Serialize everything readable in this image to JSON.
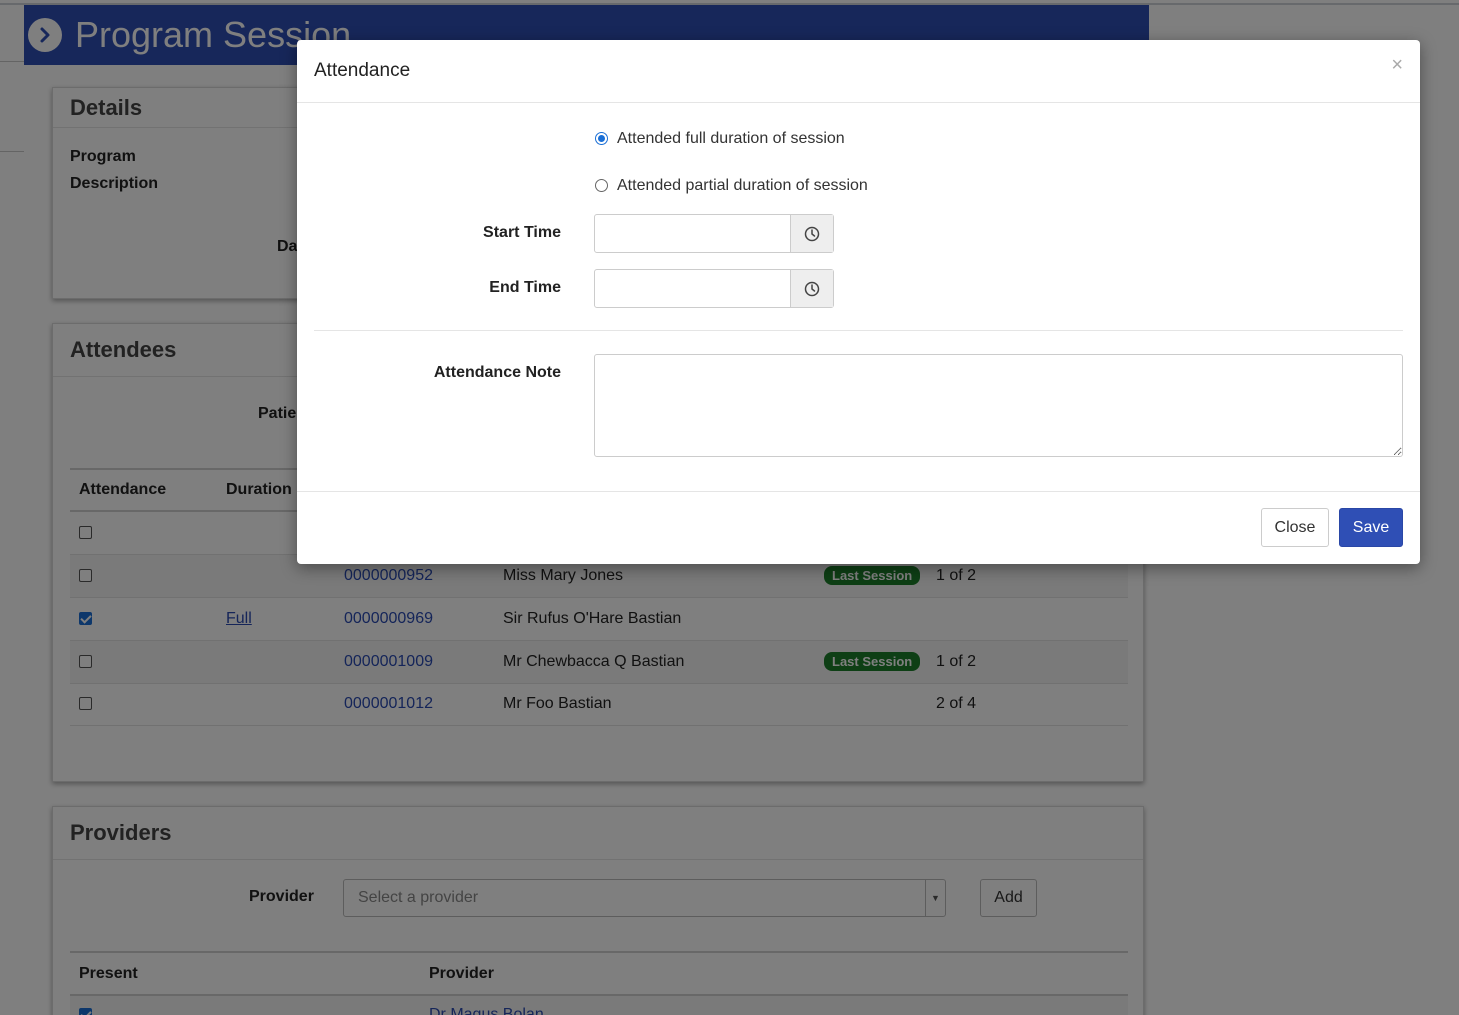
{
  "page": {
    "title": "Program Session"
  },
  "details": {
    "heading": "Details",
    "program_label": "Program",
    "description_label": "Description",
    "date_label_partial": "Dat"
  },
  "attendees": {
    "heading": "Attendees",
    "patient_label_partial": "Patien",
    "columns": {
      "attendance": "Attendance",
      "duration": "Duration"
    },
    "rows": [
      {
        "checked": false,
        "duration": "",
        "id": "",
        "name": "",
        "badge": "",
        "progress": ""
      },
      {
        "checked": false,
        "duration": "",
        "id": "0000000952",
        "name": "Miss Mary Jones",
        "badge": "Last Session",
        "progress": "1 of 2"
      },
      {
        "checked": true,
        "duration": "Full",
        "id": "0000000969",
        "name": "Sir Rufus O'Hare Bastian",
        "badge": "",
        "progress": ""
      },
      {
        "checked": false,
        "duration": "",
        "id": "0000001009",
        "name": "Mr Chewbacca Q Bastian",
        "badge": "Last Session",
        "progress": "1 of 2"
      },
      {
        "checked": false,
        "duration": "",
        "id": "0000001012",
        "name": "Mr Foo Bastian",
        "badge": "",
        "progress": "2 of 4"
      }
    ]
  },
  "providers": {
    "heading": "Providers",
    "provider_label": "Provider",
    "select_placeholder": "Select a provider",
    "add_label": "Add",
    "columns": {
      "present": "Present",
      "provider": "Provider"
    },
    "first_row_partial": "Dr Magus Bolan"
  },
  "modal": {
    "title": "Attendance",
    "close_x": "×",
    "radio_full": "Attended full duration of session",
    "radio_partial": "Attended partial duration of session",
    "selected": "full",
    "start_time_label": "Start Time",
    "start_time_value": "",
    "end_time_label": "End Time",
    "end_time_value": "",
    "note_label": "Attendance Note",
    "note_value": "",
    "close_button": "Close",
    "save_button": "Save"
  },
  "colors": {
    "brand": "#2f4fb5",
    "badge_green": "#1d7f2b",
    "link": "#2a4bb3"
  },
  "icons": [
    "chevron-right-circle-icon",
    "clock-icon",
    "close-icon",
    "caret-down-icon",
    "resize-handle-icon"
  ]
}
